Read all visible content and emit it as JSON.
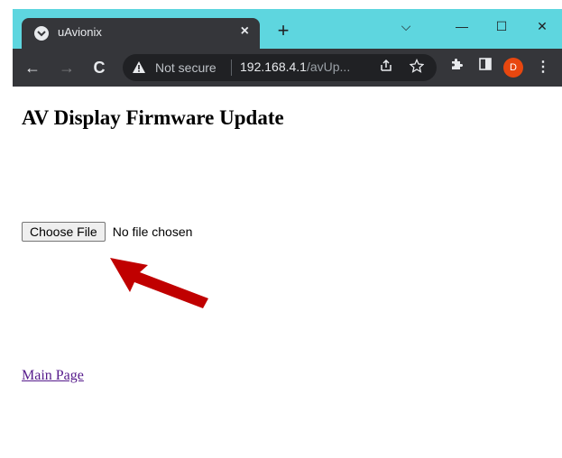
{
  "browser": {
    "tab": {
      "title": "uAvionix",
      "close": "×"
    },
    "new_tab": "+",
    "window_controls": {
      "dropdown": "⌵",
      "minimize": "—",
      "maximize": "☐",
      "close": "✕"
    },
    "nav": {
      "back": "←",
      "forward": "→",
      "reload": "C"
    },
    "omnibox": {
      "security_label": "Not secure",
      "url_host": "192.168.4.1",
      "url_path": "/avUp...",
      "share_icon": "share-icon",
      "star_icon": "star-icon"
    },
    "toolbar": {
      "extensions_icon": "puzzle-icon",
      "sidepanel_icon": "side-panel-icon",
      "profile_initial": "D",
      "menu_icon": "⋮"
    },
    "accent_color": "#5ed6df",
    "profile_color": "#e8470f"
  },
  "page": {
    "heading": "AV Display Firmware Update",
    "file_input": {
      "button_label": "Choose File",
      "status": "No file chosen"
    },
    "link": "Main Page",
    "annotation_arrow_color": "#c00000"
  }
}
